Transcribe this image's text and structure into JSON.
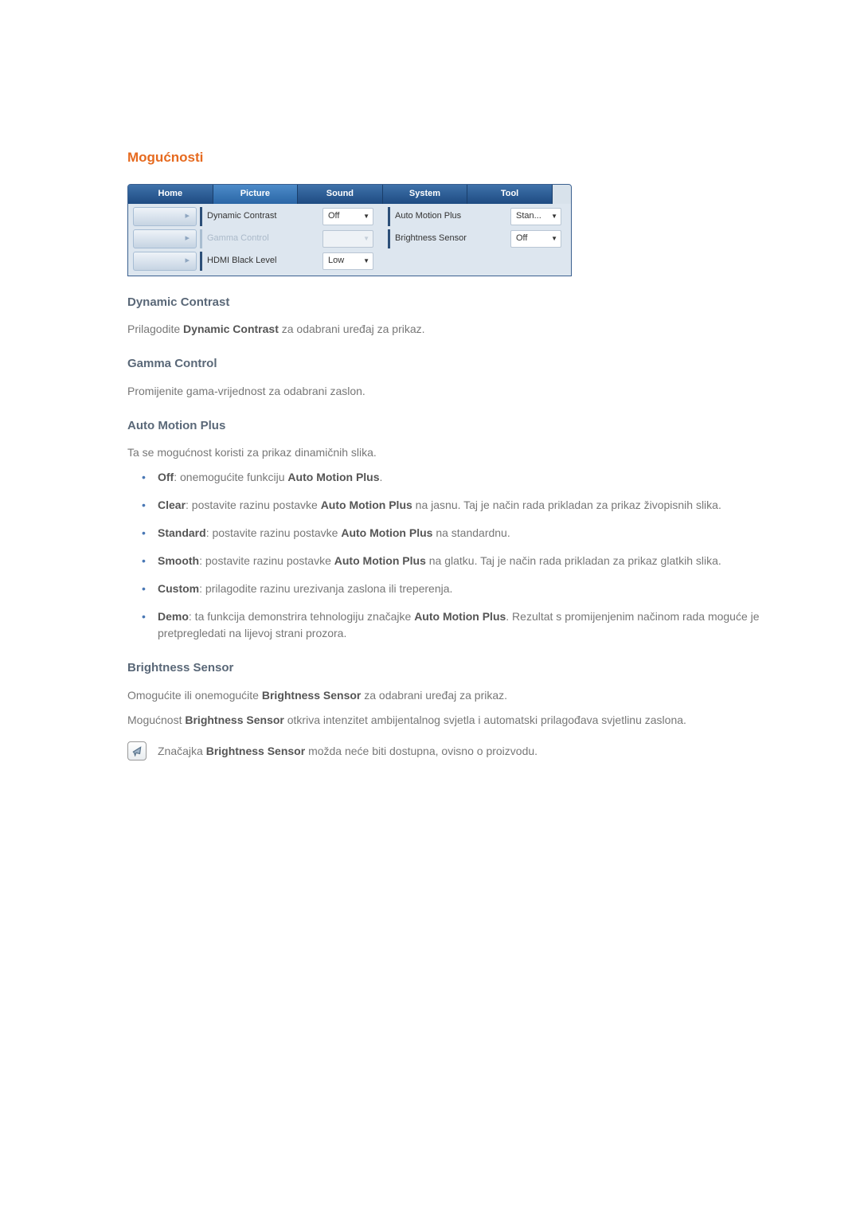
{
  "heading": "Mogućnosti",
  "tabs": {
    "home": "Home",
    "picture": "Picture",
    "sound": "Sound",
    "system": "System",
    "tool": "Tool"
  },
  "panel": {
    "rows": [
      {
        "arrow": "▸",
        "label": "Dynamic Contrast",
        "value": "Off",
        "disabled": false,
        "label2": "Auto Motion Plus",
        "value2": "Stan..."
      },
      {
        "arrow": "▸",
        "label": "Gamma Control",
        "value": "",
        "disabled": true,
        "label2": "Brightness Sensor",
        "value2": "Off"
      },
      {
        "arrow": "▸",
        "label": "HDMI Black Level",
        "value": "Low",
        "disabled": false
      }
    ]
  },
  "sections": {
    "dynamic_contrast": {
      "title": "Dynamic Contrast",
      "text_pre": "Prilagodite ",
      "text_bold": "Dynamic Contrast",
      "text_post": " za odabrani uređaj za prikaz."
    },
    "gamma_control": {
      "title": "Gamma Control",
      "text": "Promijenite gama-vrijednost za odabrani zaslon."
    },
    "amp": {
      "title": "Auto Motion Plus",
      "intro": "Ta se mogućnost koristi za prikaz dinamičnih slika.",
      "items": [
        {
          "bold": "Off",
          "mid": ": onemogućite funkciju ",
          "bold2": "Auto Motion Plus",
          "post": "."
        },
        {
          "bold": "Clear",
          "mid": ": postavite razinu postavke ",
          "bold2": "Auto Motion Plus",
          "post": " na jasnu. Taj je način rada prikladan za prikaz živopisnih slika."
        },
        {
          "bold": "Standard",
          "mid": ": postavite razinu postavke ",
          "bold2": "Auto Motion Plus",
          "post": " na standardnu."
        },
        {
          "bold": "Smooth",
          "mid": ": postavite razinu postavke ",
          "bold2": "Auto Motion Plus",
          "post": " na glatku. Taj je način rada prikladan za prikaz glatkih slika."
        },
        {
          "bold": "Custom",
          "mid": ": prilagodite razinu urezivanja zaslona ili treperenja.",
          "bold2": "",
          "post": ""
        },
        {
          "bold": "Demo",
          "mid": ": ta funkcija demonstrira tehnologiju značajke ",
          "bold2": "Auto Motion Plus",
          "post": ". Rezultat s promijenjenim načinom rada moguće je pretpregledati na lijevoj strani prozora."
        }
      ]
    },
    "bs": {
      "title": "Brightness Sensor",
      "p1_pre": "Omogućite ili onemogućite ",
      "p1_bold": "Brightness Sensor",
      "p1_post": " za odabrani uređaj za prikaz.",
      "p2_pre": "Mogućnost ",
      "p2_bold": "Brightness Sensor",
      "p2_post": " otkriva intenzitet ambijentalnog svjetla i automatski prilagođava svjetlinu zaslona.",
      "note_pre": "Značajka ",
      "note_bold": "Brightness Sensor",
      "note_post": " možda neće biti dostupna, ovisno o proizvodu."
    }
  }
}
